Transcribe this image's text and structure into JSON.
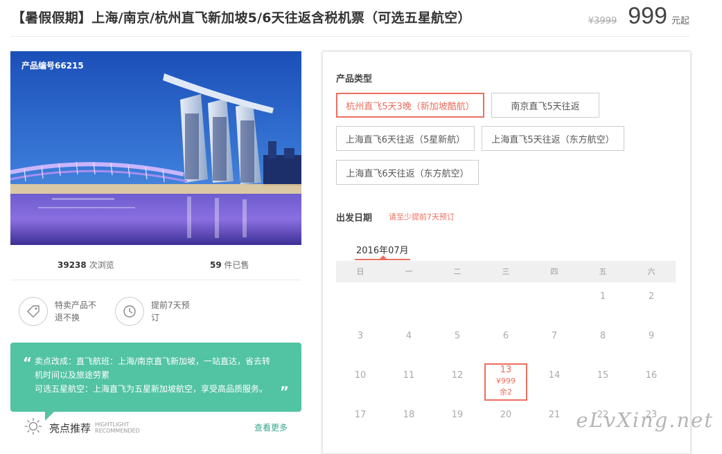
{
  "header": {
    "title": "【暑假假期】上海/南京/杭州直飞新加坡5/6天往返含税机票（可选五星航空）",
    "old_price": "¥3999",
    "price": "999",
    "price_unit": "元起"
  },
  "photo": {
    "product_no": "产品编号66215"
  },
  "stats": {
    "views_count": "39238",
    "views_label": " 次浏览",
    "sold_count": "59",
    "sold_label": " 件已售"
  },
  "features": [
    {
      "icon": "tag-icon",
      "line1": "特卖产品不",
      "line2": "退不换"
    },
    {
      "icon": "clock-icon",
      "line1": "提前7天预",
      "line2": "订"
    }
  ],
  "highlight": {
    "open_quote": "“",
    "close_quote": "”",
    "line1": "卖点改成：直飞航班：上海/南京直飞新加坡，一站直达，省去转",
    "line2": "机时间以及旅途劳累",
    "line3": "可选五星航空：上海直飞为五星新加坡航空，享受高品质服务。",
    "title": "亮点推荐",
    "sub1": "HIGHTLIGHT",
    "sub2": "RECOMMENDED",
    "more": "查看更多",
    "icon": "sun-icon"
  },
  "booking": {
    "type_label": "产品类型",
    "options": [
      {
        "label": "杭州直飞5天3晚（新加坡酷航）",
        "selected": true
      },
      {
        "label": "南京直飞5天往返",
        "selected": false
      },
      {
        "label": "上海直飞6天往返（5星新航）",
        "selected": false
      },
      {
        "label": "上海直飞5天往返（东方航空）",
        "selected": false
      },
      {
        "label": "上海直飞6天往返（东方航空）",
        "selected": false
      }
    ],
    "date_label": "出发日期",
    "date_note": "请至少提前7天预订",
    "month": "2016年07月",
    "weekdays": [
      "日",
      "一",
      "二",
      "三",
      "四",
      "五",
      "六"
    ],
    "weeks": [
      [
        "",
        "",
        "",
        "",
        "",
        "1",
        "2"
      ],
      [
        "3",
        "4",
        "5",
        "6",
        "7",
        "8",
        "9"
      ],
      [
        "10",
        "11",
        "12",
        "13",
        "14",
        "15",
        "16"
      ],
      [
        "17",
        "18",
        "19",
        "20",
        "21",
        "22",
        "23"
      ]
    ],
    "available": {
      "day": "13",
      "price": "¥999",
      "remain": "余2"
    }
  },
  "watermark": "eLvXing.net",
  "colors": {
    "accent": "#ec6e5e",
    "highlight_bg": "#52c3a3"
  }
}
